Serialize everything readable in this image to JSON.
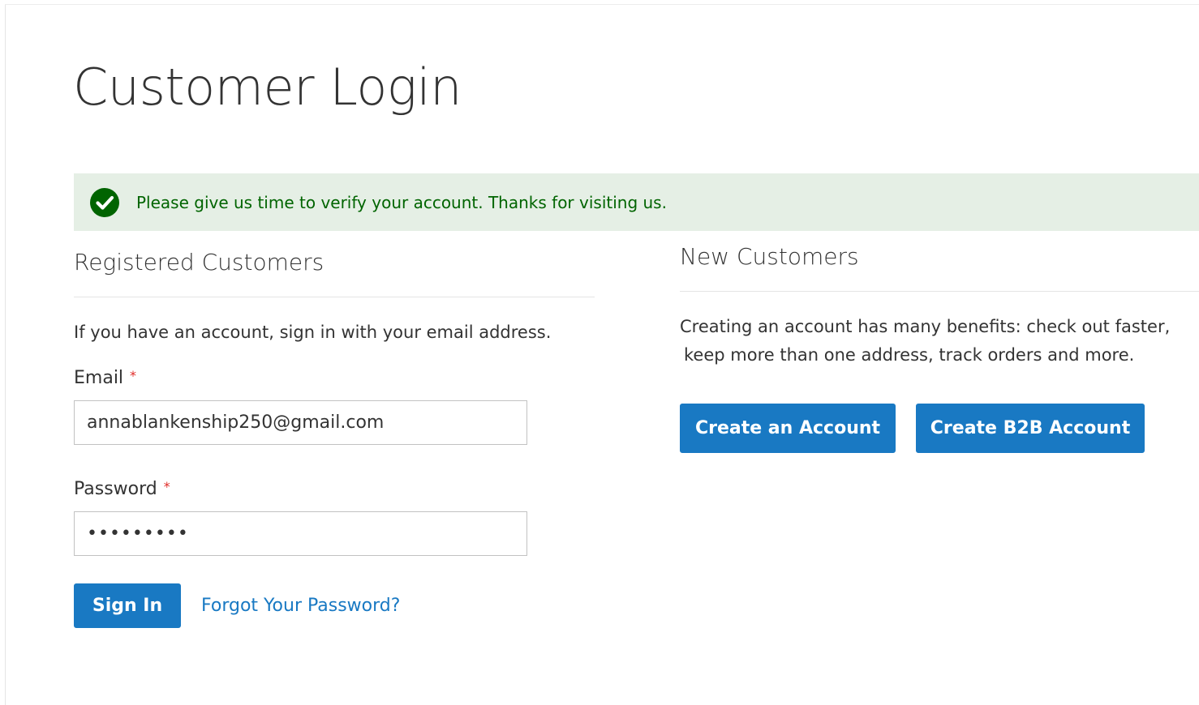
{
  "page": {
    "title": "Customer Login"
  },
  "message": {
    "text": "Please give us time to verify your account. Thanks for visiting us.",
    "icon": "check-circle-icon",
    "background_color": "#e5efe5",
    "text_color": "#006400"
  },
  "registered": {
    "title": "Registered Customers",
    "intro": "If you have an account, sign in with your email address.",
    "email": {
      "label": "Email",
      "required_mark": "*",
      "value": "annablankenship250@gmail.com"
    },
    "password": {
      "label": "Password",
      "required_mark": "*",
      "value": "•••••••••"
    },
    "sign_in_label": "Sign In",
    "forgot_label": "Forgot Your Password?"
  },
  "new_customers": {
    "title": "New Customers",
    "intro_line1": "Creating an account has many benefits: check out faster,",
    "intro_line2": "keep more than one address, track orders and more.",
    "create_account_label": "Create an Account",
    "create_b2b_label": "Create B2B Account"
  },
  "colors": {
    "primary": "#1979c3",
    "required": "#e02b27"
  }
}
